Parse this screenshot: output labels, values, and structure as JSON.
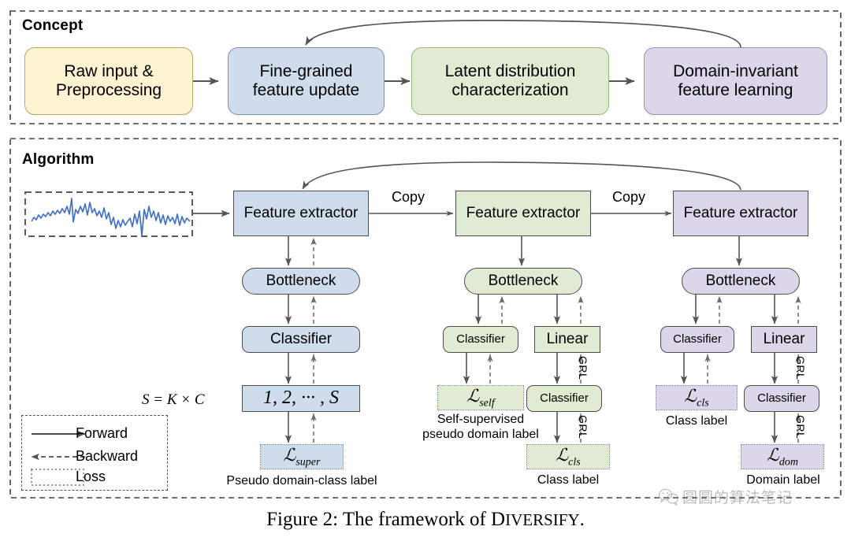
{
  "panels": {
    "concept": {
      "title": "Concept"
    },
    "algorithm": {
      "title": "Algorithm"
    }
  },
  "concept_flow": {
    "boxes": [
      {
        "label": "Raw input &\nPreprocessing",
        "color": "#fdf3d1",
        "name": "raw-input-preprocessing"
      },
      {
        "label": "Fine-grained\nfeature update",
        "color": "#cfdcec",
        "name": "fine-grained-feature-update"
      },
      {
        "label": "Latent distribution\ncharacterization",
        "color": "#e0ebd2",
        "name": "latent-distribution-characterization"
      },
      {
        "label": "Domain-invariant\nfeature learning",
        "color": "#dcd6ea",
        "name": "domain-invariant-feature-learning"
      }
    ]
  },
  "algorithm": {
    "input": {
      "caption": "",
      "signal_color": "#4472c4"
    },
    "edge_labels": {
      "copy1": "Copy",
      "copy2": "Copy"
    },
    "columns": [
      {
        "name": "supervised-column",
        "color": "#cfdcec",
        "feature_extractor": "Feature extractor",
        "bottleneck": "Bottleneck",
        "classifier": "Classifier",
        "sequence": "1, 2, ··· , S",
        "sequence_formula": "S = K × C",
        "loss": {
          "name": "L",
          "sub": "super"
        },
        "loss_caption": "Pseudo domain-class label"
      },
      {
        "name": "self-supervised-column",
        "color": "#e1ebd3",
        "feature_extractor": "Feature extractor",
        "bottleneck": "Bottleneck",
        "left_head": "Classifier",
        "right_head": "Linear",
        "right_sub_head": "Classifier",
        "left_loss": {
          "name": "L",
          "sub": "self"
        },
        "left_loss_caption": "Self-supervised\npseudo domain label",
        "right_loss": {
          "name": "L",
          "sub": "cls"
        },
        "right_loss_caption": "Class label",
        "grl_labels": [
          "GRL",
          "GRL"
        ]
      },
      {
        "name": "domain-invariant-column",
        "color": "#dcd6ea",
        "feature_extractor": "Feature extractor",
        "bottleneck": "Bottleneck",
        "left_head": "Classifier",
        "right_head": "Linear",
        "right_sub_head": "Classifier",
        "left_loss": {
          "name": "L",
          "sub": "cls"
        },
        "left_loss_caption": "Class label",
        "right_loss": {
          "name": "L",
          "sub": "dom"
        },
        "right_loss_caption": "Domain label",
        "grl_labels": [
          "GRL",
          "GRL"
        ]
      }
    ]
  },
  "legend": {
    "items": [
      {
        "label": "Forward",
        "style": "solid-arrow-right"
      },
      {
        "label": "Backward",
        "style": "dashed-arrow-left"
      },
      {
        "label": "Loss",
        "style": "dotted-box"
      }
    ]
  },
  "figure_caption": {
    "prefix": "Figure 2: The framework of ",
    "smallcaps": "DIVERSIFY",
    "suffix": "."
  },
  "watermark": {
    "text": "圆圆的算法笔记",
    "icon": "wechat-icon"
  },
  "colors": {
    "yellow": "#fdf3d1",
    "blue": "#cfdcec",
    "green": "#e1ebd3",
    "purple": "#dcd6ea",
    "arrow": "#555555",
    "signal": "#4472c4"
  }
}
